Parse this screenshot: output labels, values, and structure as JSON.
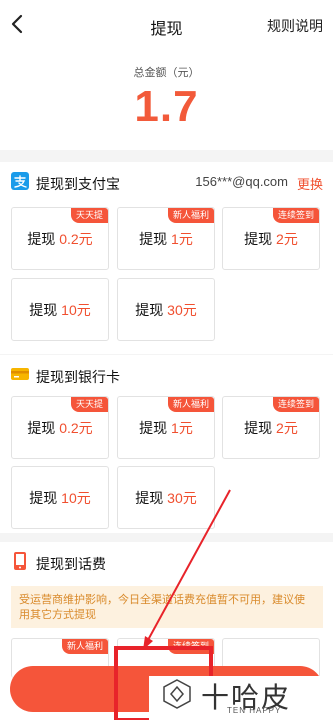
{
  "header": {
    "title": "提现",
    "rules_label": "规则说明"
  },
  "total": {
    "label": "总金额（元）",
    "amount": "1.7"
  },
  "alipay": {
    "title": "提现到支付宝",
    "account": "156***@qq.com",
    "change_label": "更换",
    "cards": [
      {
        "prefix": "提现",
        "amount": "0.2元",
        "badge": "天天提"
      },
      {
        "prefix": "提现",
        "amount": "1元",
        "badge": "新人福利"
      },
      {
        "prefix": "提现",
        "amount": "2元",
        "badge": "连续签到"
      },
      {
        "prefix": "提现",
        "amount": "10元",
        "badge": ""
      },
      {
        "prefix": "提现",
        "amount": "30元",
        "badge": ""
      }
    ]
  },
  "bankcard": {
    "title": "提现到银行卡",
    "cards": [
      {
        "prefix": "提现",
        "amount": "0.2元",
        "badge": "天天提"
      },
      {
        "prefix": "提现",
        "amount": "1元",
        "badge": "新人福利"
      },
      {
        "prefix": "提现",
        "amount": "2元",
        "badge": "连续签到"
      },
      {
        "prefix": "提现",
        "amount": "10元",
        "badge": ""
      },
      {
        "prefix": "提现",
        "amount": "30元",
        "badge": ""
      }
    ]
  },
  "phone": {
    "title": "提现到话费",
    "notice": "受运营商维护影响，今日全渠道话费充值暂不可用，建议使用其它方式提现",
    "badges": [
      "新人福利",
      "连续签到"
    ]
  },
  "watermark": {
    "text": "十哈皮",
    "sub": "TEN HAPPY"
  },
  "colors": {
    "accent": "#f5553a",
    "amount": "#f25a3a",
    "notice_bg": "#fdf1df",
    "notice_text": "#d98a2b",
    "alipay_blue": "#1a9bea",
    "bank_yellow": "#f7b500"
  }
}
